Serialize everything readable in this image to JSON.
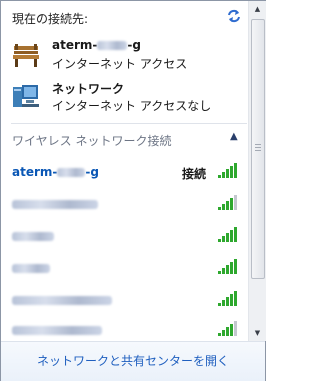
{
  "header": {
    "title": "現在の接続先:",
    "refresh_icon": "refresh-icon"
  },
  "connections": [
    {
      "icon": "bench-network-icon",
      "name_prefix": "aterm-",
      "name_suffix": "-g",
      "status": "インターネット アクセス"
    },
    {
      "icon": "computer-network-icon",
      "name": "ネットワーク",
      "status": "インターネット アクセスなし"
    }
  ],
  "wireless": {
    "section_title": "ワイヤレス ネットワーク接続",
    "collapse_icon": "chevron-up-icon",
    "networks": [
      {
        "name_prefix": "aterm-",
        "name_suffix": "-g",
        "state": "接続",
        "active": true,
        "signal": 5
      },
      {
        "signal": 4
      },
      {
        "signal": 5
      },
      {
        "signal": 5
      },
      {
        "signal": 5
      },
      {
        "signal": 4
      }
    ]
  },
  "footer": {
    "link": "ネットワークと共有センターを開く"
  },
  "colors": {
    "accent": "#0a57b5",
    "link": "#1f5fbf",
    "signal_on": "#2ea82e",
    "signal_off": "#c4c8cf"
  }
}
